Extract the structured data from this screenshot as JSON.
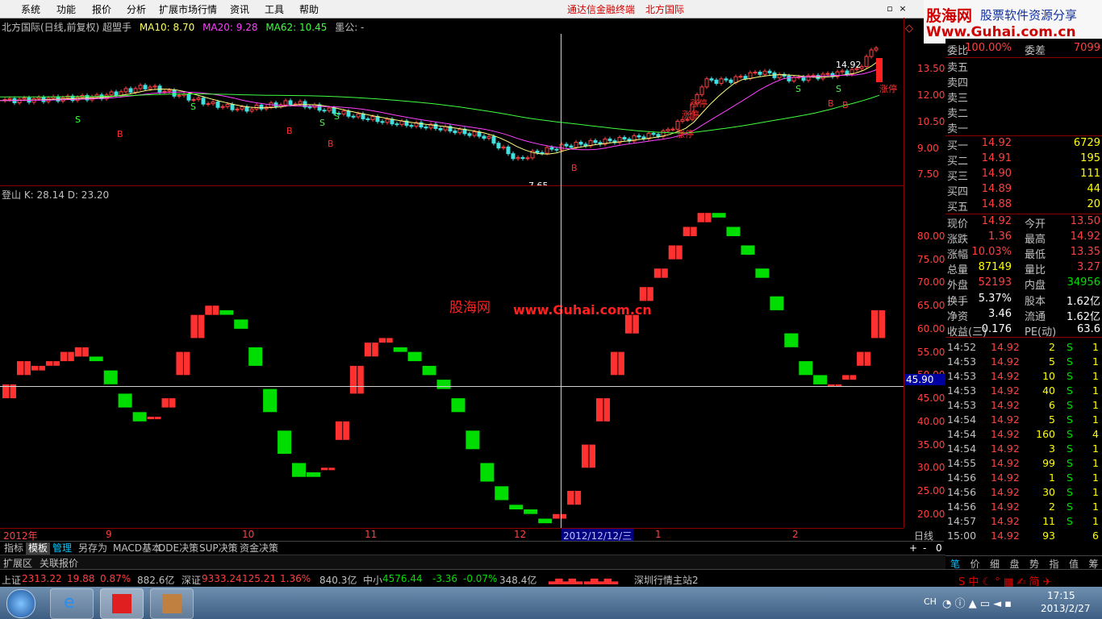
{
  "menubar": {
    "items": [
      "系统",
      "功能",
      "报价",
      "分析",
      "扩展市场行情",
      "资讯",
      "工具",
      "帮助"
    ],
    "center_title": "通达信金融终端",
    "broker": "北方国际"
  },
  "logo": {
    "brand": "股海网",
    "slogan": "股票软件资源分享",
    "url": "Www.Guhai.com.cn"
  },
  "watermark": {
    "brand": "股海网",
    "url": "www.Guhai.com.cn"
  },
  "header": {
    "stock": "北方国际(日线,前复权) 超盟手",
    "ma10": "MA10: 8.70",
    "ma20": "MA20: 9.28",
    "ma62": "MA62: 10.45",
    "extra": "墨公: -"
  },
  "indicator_header": "登山  K: 28.14  D: 23.20",
  "price_axis": [
    "13.50",
    "12.00",
    "10.50",
    "9.00",
    "7.50"
  ],
  "indicator_axis": [
    "80.00",
    "75.00",
    "70.00",
    "65.00",
    "60.00",
    "55.00",
    "50.00",
    "45.00",
    "40.00",
    "35.00",
    "30.00",
    "25.00",
    "20.00"
  ],
  "crosshair_value": "45.90",
  "annotations": {
    "high": "14.92",
    "low": "7.65",
    "limit_up": "涨停",
    "sell": "S",
    "buy": "B"
  },
  "time_axis": [
    "2012年",
    "9",
    "10",
    "11",
    "12",
    "2012/12/12/三",
    "1",
    "2"
  ],
  "period": "日线",
  "quote": {
    "weibi_label": "委比",
    "weibi": "100.00%",
    "weicha_label": "委差",
    "weicha": "7099",
    "sells": [
      {
        "label": "卖五"
      },
      {
        "label": "卖四"
      },
      {
        "label": "卖三"
      },
      {
        "label": "卖二"
      },
      {
        "label": "卖一"
      }
    ],
    "buys": [
      {
        "label": "买一",
        "price": "14.92",
        "vol": "6729"
      },
      {
        "label": "买二",
        "price": "14.91",
        "vol": "195"
      },
      {
        "label": "买三",
        "price": "14.90",
        "vol": "111"
      },
      {
        "label": "买四",
        "price": "14.89",
        "vol": "44"
      },
      {
        "label": "买五",
        "price": "14.88",
        "vol": "20"
      }
    ],
    "stats": [
      {
        "l1": "现价",
        "v1": "14.92",
        "l2": "今开",
        "v2": "13.50"
      },
      {
        "l1": "涨跌",
        "v1": "1.36",
        "l2": "最高",
        "v2": "14.92"
      },
      {
        "l1": "涨幅",
        "v1": "10.03%",
        "l2": "最低",
        "v2": "13.35"
      },
      {
        "l1": "总量",
        "v1": "87149",
        "l2": "量比",
        "v2": "3.27"
      },
      {
        "l1": "外盘",
        "v1": "52193",
        "l2": "内盘",
        "v2": "34956"
      },
      {
        "l1": "换手",
        "v1": "5.37%",
        "l2": "股本",
        "v2": "1.62亿"
      },
      {
        "l1": "净资",
        "v1": "3.46",
        "l2": "流通",
        "v2": "1.62亿"
      },
      {
        "l1": "收益(三)",
        "v1": "0.176",
        "l2": "PE(动)",
        "v2": "63.6"
      }
    ],
    "ticks": [
      {
        "t": "14:52",
        "p": "14.92",
        "v": "2",
        "s": "S",
        "n": "1"
      },
      {
        "t": "14:53",
        "p": "14.92",
        "v": "5",
        "s": "S",
        "n": "1"
      },
      {
        "t": "14:53",
        "p": "14.92",
        "v": "10",
        "s": "S",
        "n": "1"
      },
      {
        "t": "14:53",
        "p": "14.92",
        "v": "40",
        "s": "S",
        "n": "1"
      },
      {
        "t": "14:53",
        "p": "14.92",
        "v": "6",
        "s": "S",
        "n": "1"
      },
      {
        "t": "14:54",
        "p": "14.92",
        "v": "5",
        "s": "S",
        "n": "1"
      },
      {
        "t": "14:54",
        "p": "14.92",
        "v": "160",
        "s": "S",
        "n": "4"
      },
      {
        "t": "14:54",
        "p": "14.92",
        "v": "3",
        "s": "S",
        "n": "1"
      },
      {
        "t": "14:55",
        "p": "14.92",
        "v": "99",
        "s": "S",
        "n": "1"
      },
      {
        "t": "14:56",
        "p": "14.92",
        "v": "1",
        "s": "S",
        "n": "1"
      },
      {
        "t": "14:56",
        "p": "14.92",
        "v": "30",
        "s": "S",
        "n": "1"
      },
      {
        "t": "14:56",
        "p": "14.92",
        "v": "2",
        "s": "S",
        "n": "1"
      },
      {
        "t": "14:57",
        "p": "14.92",
        "v": "11",
        "s": "S",
        "n": "1"
      },
      {
        "t": "15:00",
        "p": "14.92",
        "v": "93",
        "s": "",
        "n": "6"
      }
    ],
    "bottom_tabs": [
      "笔",
      "价",
      "细",
      "盘",
      "势",
      "指",
      "值",
      "筹"
    ]
  },
  "tabs": [
    "指标",
    "模板",
    "管理",
    "另存为",
    "MACD基本",
    "DDE决策",
    "SUP决策",
    "资金决策"
  ],
  "tab_controls": [
    "+",
    "-",
    "0"
  ],
  "expand_bar": [
    "扩展区",
    "关联报价"
  ],
  "status": {
    "sh_label": "上证",
    "sh_val": "2313.22",
    "sh_chg": "19.88",
    "sh_pct": "0.87%",
    "sh_amt": "882.6亿",
    "sz_label": "深证",
    "sz_val": "9333.24",
    "sz_chg": "125.21",
    "sz_pct": "1.36%",
    "sz_amt": "840.3亿",
    "zx_label": "中小",
    "zx_val": "4576.44",
    "zx_chg": "-3.36",
    "zx_pct": "-0.07%",
    "zx_amt": "348.4亿",
    "server": "深圳行情主站2"
  },
  "taskbar": {
    "lang": "CH",
    "time": "17:15",
    "date": "2013/2/27"
  },
  "chart_data": {
    "type": "bar",
    "title": "登山  K: 28.14  D: 23.20",
    "ylim": [
      17,
      88
    ],
    "x_labels": [
      "2012年",
      "9",
      "10",
      "11",
      "12",
      "2012/12/12/三",
      "1",
      "2"
    ],
    "series": [
      {
        "name": "K",
        "values": [
          48,
          53,
          52,
          53,
          55,
          56,
          53,
          48,
          43,
          40,
          41,
          45,
          55,
          63,
          65,
          63,
          60,
          52,
          42,
          33,
          28,
          28,
          30,
          40,
          52,
          57,
          58,
          55,
          53,
          50,
          47,
          42,
          34,
          27,
          23,
          21,
          20,
          18,
          20,
          25,
          35,
          45,
          55,
          63,
          69,
          73,
          78,
          82,
          85,
          84,
          80,
          76,
          71,
          64,
          56,
          50,
          48,
          48,
          50,
          55,
          64
        ]
      },
      {
        "name": "D",
        "values": [
          45,
          50,
          51,
          52,
          53,
          54,
          54,
          51,
          46,
          42,
          41,
          43,
          50,
          58,
          63,
          64,
          62,
          56,
          47,
          38,
          31,
          29,
          30,
          36,
          46,
          54,
          57,
          56,
          55,
          52,
          49,
          45,
          38,
          31,
          26,
          22,
          21,
          19,
          19,
          22,
          30,
          40,
          50,
          59,
          66,
          71,
          75,
          80,
          83,
          85,
          82,
          78,
          73,
          67,
          59,
          53,
          50,
          48,
          49,
          52,
          58
        ]
      }
    ]
  }
}
